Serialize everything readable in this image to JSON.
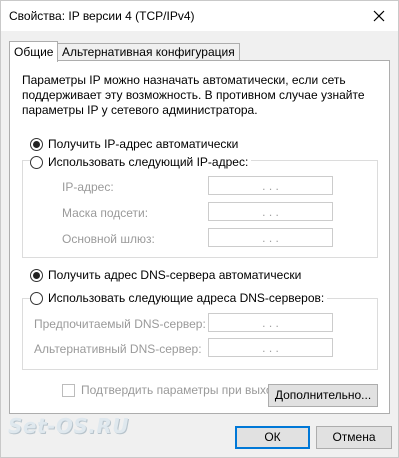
{
  "window": {
    "title": "Свойства: IP версии 4 (TCP/IPv4)",
    "close_icon": "close-icon"
  },
  "tabs": [
    {
      "label": "Общие",
      "active": true
    },
    {
      "label": "Альтернативная конфигурация",
      "active": false
    }
  ],
  "description": "Параметры IP можно назначать автоматически, если сеть поддерживает эту возможность. В противном случае узнайте параметры IP у сетевого администратора.",
  "ip": {
    "auto_label": "Получить IP-адрес автоматически",
    "auto_selected": true,
    "manual_label": "Использовать следующий IP-адрес:",
    "manual_selected": false,
    "fields": [
      {
        "label": "IP-адрес:",
        "value": ". . ."
      },
      {
        "label": "Маска подсети:",
        "value": ". . ."
      },
      {
        "label": "Основной шлюз:",
        "value": ". . ."
      }
    ]
  },
  "dns": {
    "auto_label": "Получить адрес DNS-сервера автоматически",
    "auto_selected": true,
    "manual_label": "Использовать следующие адреса DNS-серверов:",
    "manual_selected": false,
    "fields": [
      {
        "label": "Предпочитаемый DNS-сервер:",
        "value": ". . ."
      },
      {
        "label": "Альтернативный DNS-сервер:",
        "value": ". . ."
      }
    ]
  },
  "validate_checkbox": {
    "label": "Подтвердить параметры при выходе",
    "checked": false,
    "enabled": false
  },
  "buttons": {
    "advanced": "Дополнительно...",
    "ok": "ОК",
    "cancel": "Отмена"
  },
  "watermark": "Set-OS.RU"
}
